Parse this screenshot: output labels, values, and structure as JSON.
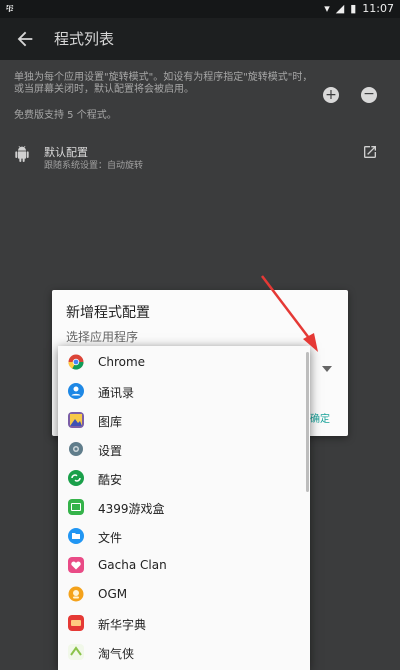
{
  "status_bar": {
    "left_icon": "cat-icon",
    "time": "11:07"
  },
  "app_bar": {
    "title": "程式列表"
  },
  "info": {
    "line1": "单独为每个应用设置\"旋转模式\"。如设有为程序指定\"旋转模式\"时，或当屏幕关闭时，默认配置将会被启用。",
    "line2": "免费版支持 5 个程式。"
  },
  "default_config": {
    "title": "默认配置",
    "subtitle": "跟随系统设置：自动旋转"
  },
  "dialog": {
    "title": "新增程式配置",
    "subtitle": "选择应用程序",
    "confirm": "确定"
  },
  "apps": [
    {
      "label": "Chrome",
      "icon": "chrome-icon",
      "color": "#4285f4"
    },
    {
      "label": "通讯录",
      "icon": "contacts-icon",
      "color": "#1e88e5"
    },
    {
      "label": "图库",
      "icon": "gallery-icon",
      "color": "#7b5ea7"
    },
    {
      "label": "设置",
      "icon": "settings-icon",
      "color": "#607d8b"
    },
    {
      "label": "酷安",
      "icon": "coolapk-icon",
      "color": "#1aa04a"
    },
    {
      "label": "4399游戏盒",
      "icon": "4399-icon",
      "color": "#35b34a"
    },
    {
      "label": "文件",
      "icon": "files-icon",
      "color": "#2196f3"
    },
    {
      "label": "Gacha Clan",
      "icon": "gacha-icon",
      "color": "#e94b86"
    },
    {
      "label": "OGM",
      "icon": "ogm-icon",
      "color": "#f4a21b"
    },
    {
      "label": "新华字典",
      "icon": "dictionary-icon",
      "color": "#e53935"
    },
    {
      "label": "淘气侠",
      "icon": "taoqixia-icon",
      "color": "#8bc34a"
    }
  ],
  "colors": {
    "accent": "#1aa39a",
    "arrow": "#e53935"
  }
}
